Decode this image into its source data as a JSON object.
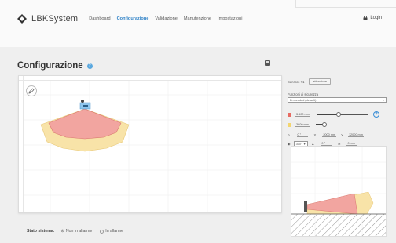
{
  "brand": {
    "name": "LBKSystem"
  },
  "nav": {
    "items": [
      {
        "label": "Dashboard",
        "active": false
      },
      {
        "label": "Configurazione",
        "active": true
      },
      {
        "label": "Validazione",
        "active": false
      },
      {
        "label": "Manutenzione",
        "active": false
      },
      {
        "label": "Impostazioni",
        "active": false
      }
    ],
    "login_label": "Login"
  },
  "page": {
    "title": "Configurazione"
  },
  "panel": {
    "sensor_label": "Sensore #1",
    "sensor_button": "attenzione",
    "function_label": "Funzioni di sicurezza",
    "function_value": "Embedded (default)",
    "zone1_value": "3.500 mm",
    "zone2_value": "3600 mm",
    "angle_label": "0 °",
    "angle_value": "2000 mm",
    "y_value": "12000 mm",
    "tilt_select": "300°",
    "tilt_value": "0 °",
    "z_value": "0 mm"
  },
  "status": {
    "label": "Stato sistema:",
    "option1": "Non in allarme",
    "option2": "In allarme"
  },
  "colors": {
    "accent": "#2a7fc6",
    "danger_zone": "#f2a5a0",
    "warning_zone": "#f8e3a8"
  },
  "icons": [
    "logo-mark-icon",
    "lock-icon",
    "help-icon",
    "save-icon",
    "pencil-icon",
    "sensor-icon"
  ]
}
